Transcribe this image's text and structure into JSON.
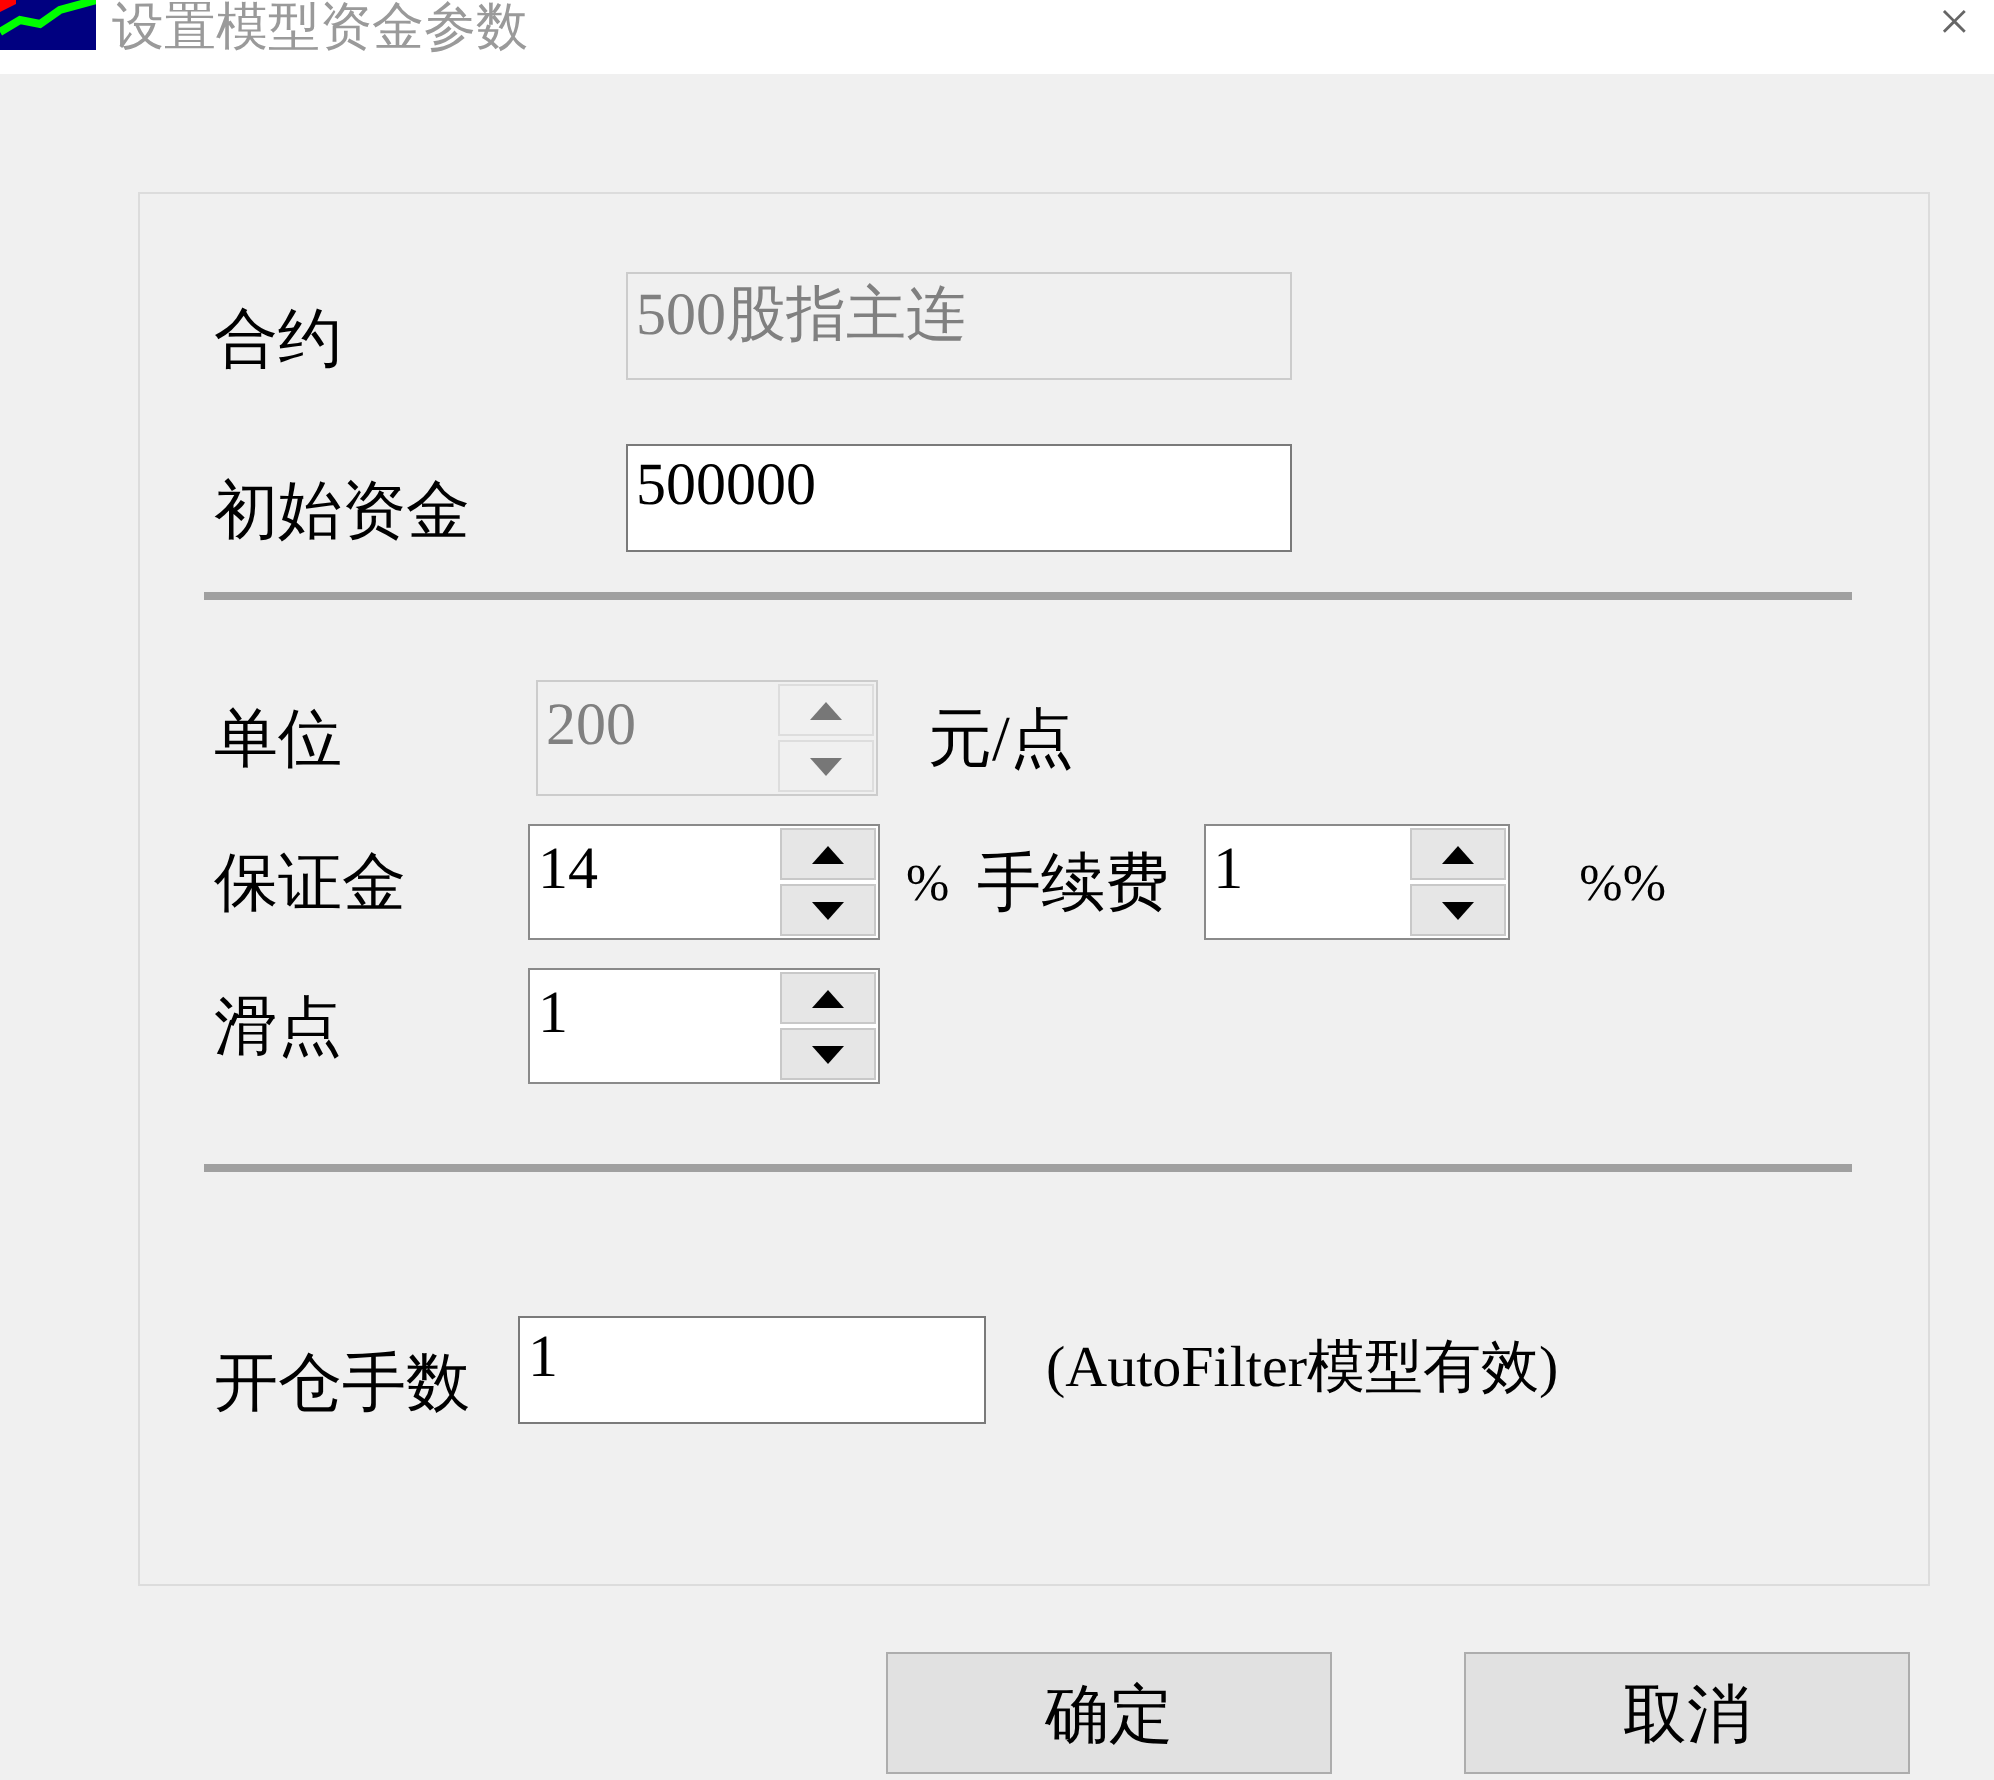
{
  "window": {
    "title": "设置模型资金参数",
    "close": "×"
  },
  "contract": {
    "label": "合约",
    "value": "500股指主连",
    "disabled": true
  },
  "capital": {
    "label": "初始资金",
    "value": "500000",
    "disabled": false
  },
  "unit": {
    "label": "单位",
    "value": "200",
    "disabled": true,
    "suffix": "元/点"
  },
  "margin": {
    "label": "保证金",
    "value": "14",
    "disabled": false,
    "suffix": "%"
  },
  "fee": {
    "label": "手续费",
    "value": "1",
    "disabled": false,
    "suffix": "%%"
  },
  "slippage": {
    "label": "滑点",
    "value": "1",
    "disabled": false
  },
  "lots": {
    "label": "开仓手数",
    "value": "1",
    "disabled": false,
    "note": "(AutoFilter模型有效)"
  },
  "buttons": [
    "确定",
    "取消"
  ]
}
